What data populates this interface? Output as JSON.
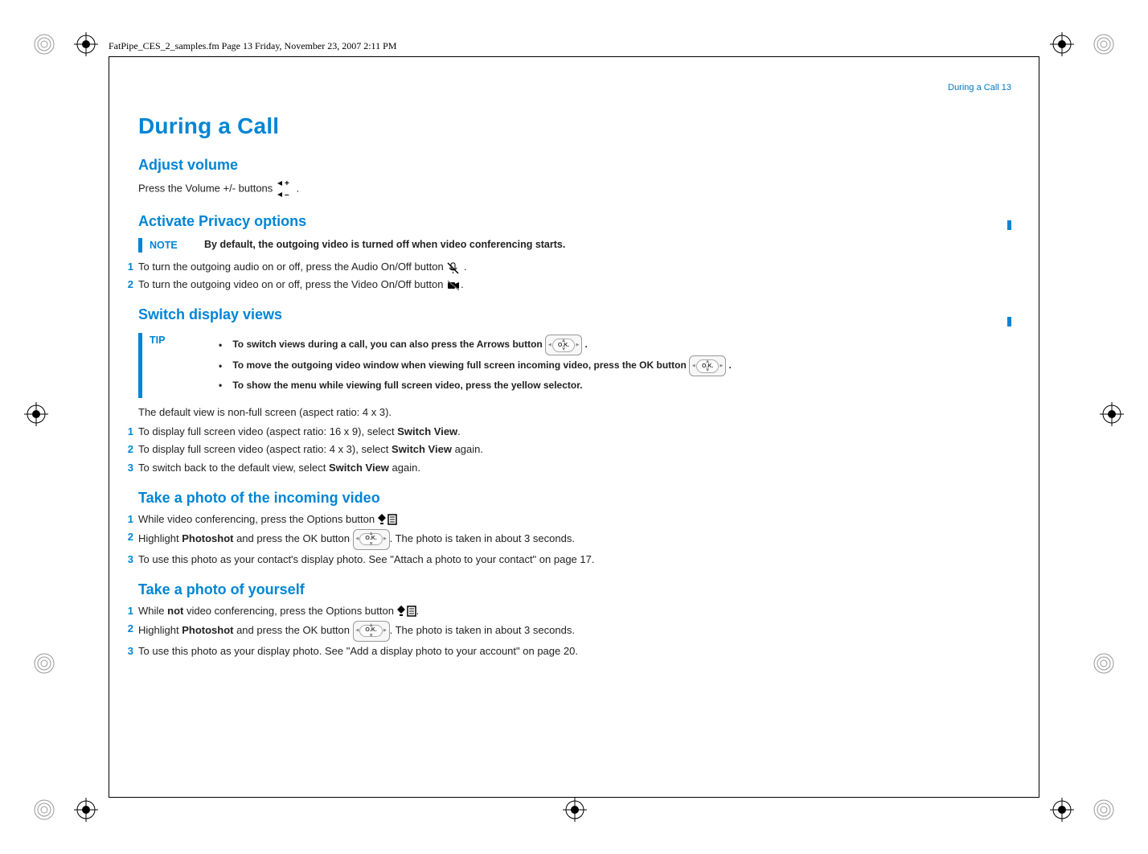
{
  "header_line": "FatPipe_CES_2_samples.fm  Page 13  Friday, November 23, 2007  2:11 PM",
  "running_head": "During a Call  13",
  "title": "During a Call",
  "adjust_volume": {
    "heading": "Adjust volume",
    "text": "Press the Volume +/- buttons"
  },
  "privacy": {
    "heading": "Activate Privacy options",
    "note_label": "NOTE",
    "note_text": "By default, the outgoing video is turned off when video conferencing starts.",
    "steps": [
      {
        "num": "1",
        "text": "To turn the outgoing audio on or off, press the Audio On/Off button"
      },
      {
        "num": "2",
        "text": "To turn the outgoing video on or off, press the Video On/Off button"
      }
    ]
  },
  "switch_views": {
    "heading": "Switch display views",
    "tip_label": "TIP",
    "tips": [
      "To switch views during a call, you can also press the Arrows button",
      "To move the outgoing video window when viewing full screen incoming video, press the OK button",
      "To show the menu while viewing full screen video, press the yellow selector."
    ],
    "default_text": "The default view is non-full screen (aspect ratio: 4 x 3).",
    "steps": [
      {
        "num": "1",
        "pre": "To display full screen video (aspect ratio: 16 x 9), select ",
        "bold": "Switch View",
        "post": "."
      },
      {
        "num": "2",
        "pre": "To display full screen video (aspect ratio: 4 x 3), select ",
        "bold": "Switch View",
        "post": " again."
      },
      {
        "num": "3",
        "pre": "To switch back to the default view, select ",
        "bold": "Switch View",
        "post": " again."
      }
    ]
  },
  "photo_incoming": {
    "heading": "Take a photo of the incoming video",
    "steps": [
      {
        "num": "1",
        "pre": "While video conferencing, press the Options button ",
        "icon": "options"
      },
      {
        "num": "2",
        "pre": "Highlight ",
        "bold": "Photoshot",
        "mid": " and press the OK button ",
        "icon": "ok",
        "post": ". The photo is taken in about 3 seconds."
      },
      {
        "num": "3",
        "text": "To use this photo as your contact's display photo. See \"Attach a photo to your contact\" on page 17."
      }
    ]
  },
  "photo_self": {
    "heading": "Take a photo of yourself",
    "steps": [
      {
        "num": "1",
        "pre": "While ",
        "bold": "not",
        "mid": " video conferencing, press the Options button ",
        "icon": "options",
        "post": "."
      },
      {
        "num": "2",
        "pre": "Highlight ",
        "bold": "Photoshot",
        "mid": " and press the OK button ",
        "icon": "ok",
        "post": ". The photo is taken in about 3 seconds."
      },
      {
        "num": "3",
        "text": "To use this photo as your display photo. See \"Add a display photo to your account\" on page 20."
      }
    ]
  }
}
